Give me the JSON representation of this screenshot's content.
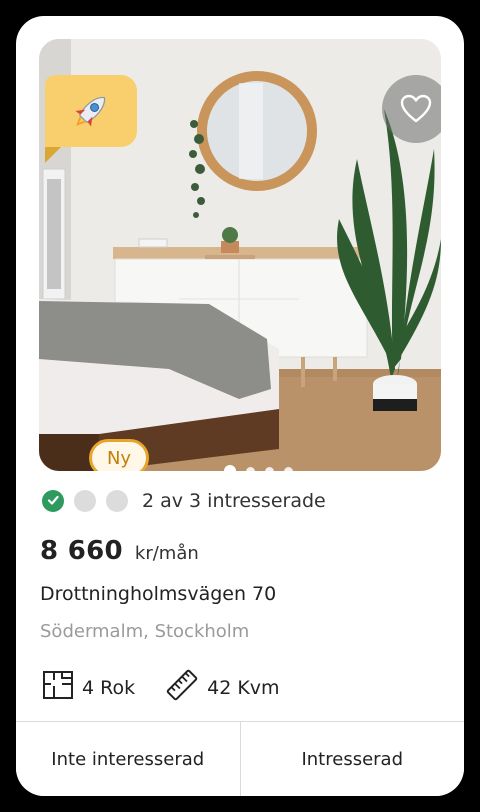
{
  "listing": {
    "badge_new": "Ny",
    "boost_icon": "rocket-icon",
    "favorite_icon": "heart-icon",
    "carousel": {
      "total": 4,
      "active": 1
    },
    "interest": {
      "filled": 1,
      "total": 3,
      "text": "2 av 3 intresserade"
    },
    "price": "8 660",
    "price_unit": "kr/mån",
    "address": "Drottningholmsvägen 70",
    "area": "Södermalm, Stockholm",
    "rooms": "4 Rok",
    "size": "42 Kvm",
    "colors": {
      "accent": "#f9cf6e",
      "new_badge": "#e7a52c",
      "check": "#2f9a5e"
    }
  },
  "actions": {
    "not_interested": "Inte interesserad",
    "interested": "Intresserad"
  }
}
